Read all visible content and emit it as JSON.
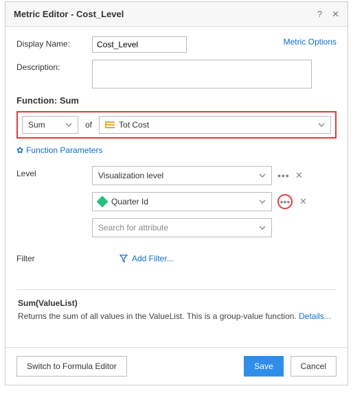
{
  "header": {
    "title": "Metric Editor - Cost_Level"
  },
  "form": {
    "displayName_label": "Display Name:",
    "displayName_value": "Cost_Level",
    "description_label": "Description:",
    "description_value": "",
    "metricOptions": "Metric Options"
  },
  "function": {
    "heading": "Function: Sum",
    "selected": "Sum",
    "of": "of",
    "argument": "Tot Cost",
    "paramsLabel": "Function Parameters"
  },
  "level": {
    "label": "Level",
    "items": [
      {
        "label": "Visualization level",
        "iconType": "none"
      },
      {
        "label": "Quarter Id",
        "iconType": "attribute"
      }
    ],
    "searchPlaceholder": "Search for attribute"
  },
  "filter": {
    "label": "Filter",
    "addFilter": "Add Filter..."
  },
  "help": {
    "title": "Sum(ValueList)",
    "desc": "Returns the sum of all values in the ValueList. This is a group-value function. ",
    "details": "Details..."
  },
  "footer": {
    "formula": "Switch to Formula Editor",
    "save": "Save",
    "cancel": "Cancel"
  }
}
